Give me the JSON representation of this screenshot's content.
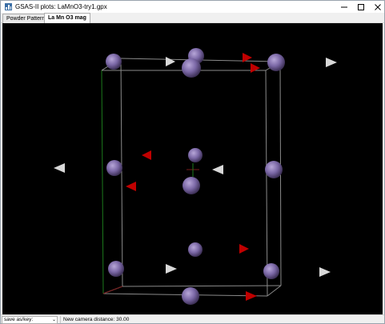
{
  "window": {
    "title": "GSAS-II plots: LaMnO3-try1.gpx",
    "icon": "gsas-icon",
    "controls": [
      "minimize-icon",
      "maximize-icon",
      "close-icon"
    ]
  },
  "tabs": [
    {
      "label": "Powder Patterns",
      "selected": false
    },
    {
      "label": "La Mn O3 mag",
      "selected": true
    }
  ],
  "status": {
    "save_label": "save as/key:",
    "message": "New camera distance: 30.00"
  },
  "colors": {
    "background": "#000000",
    "atom": "#7b68a6",
    "moment_red": "#c00000",
    "moment_white": "#d8d8d8",
    "cell_edge": "#8a8a8a",
    "axis_green": "#1c7a1c",
    "axis_red": "#7a1c1c"
  }
}
